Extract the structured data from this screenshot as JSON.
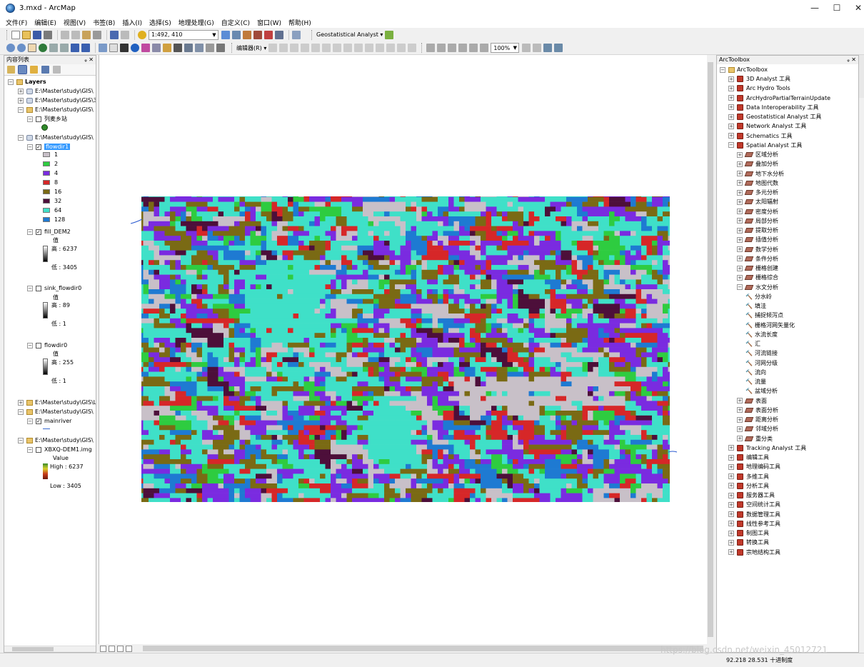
{
  "window": {
    "title": "3.mxd - ArcMap",
    "minimize": "—",
    "maximize": "☐",
    "close": "✕"
  },
  "menus": [
    "文件(F)",
    "编辑(E)",
    "视图(V)",
    "书签(B)",
    "插入(I)",
    "选择(S)",
    "地理处理(G)",
    "自定义(C)",
    "窗口(W)",
    "帮助(H)"
  ],
  "toolbar1": {
    "scale": "1:492, 410",
    "geostat_label": "Geostatistical Analyst ▾"
  },
  "toolbar2": {
    "editor_label": "编辑器(R) ▾",
    "zoom_percent": "100%"
  },
  "toc": {
    "title": "内容列表",
    "root": "Layers",
    "nodes": [
      {
        "label": "E:\\Master\\study\\GIS\\"
      },
      {
        "label": "E:\\Master\\study\\GIS\\3"
      },
      {
        "label": "E:\\Master\\study\\GIS\\"
      },
      {
        "label": "列麦乡站"
      },
      {
        "label": "E:\\Master\\study\\GIS\\"
      },
      {
        "label": "flowdir1"
      },
      {
        "label": "fill_DEM2"
      },
      {
        "label": "值"
      },
      {
        "label": "高 : 6237"
      },
      {
        "label": "低 : 3405"
      },
      {
        "label": "sink_flowdir0"
      },
      {
        "label": "值"
      },
      {
        "label": "高 : 89"
      },
      {
        "label": "低 : 1"
      },
      {
        "label": "flowdir0"
      },
      {
        "label": "值"
      },
      {
        "label": "高 : 255"
      },
      {
        "label": "低 : 1"
      },
      {
        "label": "E:\\Master\\study\\GIS\\L"
      },
      {
        "label": "E:\\Master\\study\\GIS\\"
      },
      {
        "label": "mainriver"
      },
      {
        "label": "E:\\Master\\study\\GIS\\"
      },
      {
        "label": "XBXQ-DEM1.img"
      },
      {
        "label": "Value"
      },
      {
        "label": "High : 6237"
      },
      {
        "label": "Low : 3405"
      }
    ],
    "legend": [
      {
        "label": "1",
        "color": "#c8c0c8"
      },
      {
        "label": "2",
        "color": "#2ecc40"
      },
      {
        "label": "4",
        "color": "#7a2be0"
      },
      {
        "label": "8",
        "color": "#d62728"
      },
      {
        "label": "16",
        "color": "#7a6a14"
      },
      {
        "label": "32",
        "color": "#4d0f3a"
      },
      {
        "label": "64",
        "color": "#3fe0c8"
      },
      {
        "label": "128",
        "color": "#1e7ad2"
      }
    ]
  },
  "toolbox": {
    "title": "ArcToolbox",
    "root": "ArcToolbox",
    "items": [
      {
        "label": "3D Analyst 工具"
      },
      {
        "label": "Arc Hydro Tools"
      },
      {
        "label": "ArcHydroPartialTerrainUpdate"
      },
      {
        "label": "Data Interoperability 工具"
      },
      {
        "label": "Geostatistical Analyst 工具"
      },
      {
        "label": "Network Analyst 工具"
      },
      {
        "label": "Schematics 工具"
      },
      {
        "label": "Spatial Analyst 工具"
      },
      {
        "label": "区域分析"
      },
      {
        "label": "叠加分析"
      },
      {
        "label": "地下水分析"
      },
      {
        "label": "地图代数"
      },
      {
        "label": "多元分析"
      },
      {
        "label": "太阳辐射"
      },
      {
        "label": "密度分析"
      },
      {
        "label": "局部分析"
      },
      {
        "label": "提取分析"
      },
      {
        "label": "插值分析"
      },
      {
        "label": "数学分析"
      },
      {
        "label": "条件分析"
      },
      {
        "label": "栅格创建"
      },
      {
        "label": "栅格综合"
      },
      {
        "label": "水文分析"
      },
      {
        "label": "分水岭"
      },
      {
        "label": "填洼"
      },
      {
        "label": "捕捉倾泻点"
      },
      {
        "label": "栅格河网矢量化"
      },
      {
        "label": "水流长度"
      },
      {
        "label": "汇"
      },
      {
        "label": "河流链接"
      },
      {
        "label": "河网分级"
      },
      {
        "label": "流向"
      },
      {
        "label": "流量"
      },
      {
        "label": "盆域分析"
      },
      {
        "label": "表面"
      },
      {
        "label": "表面分析"
      },
      {
        "label": "距离分析"
      },
      {
        "label": "邻域分析"
      },
      {
        "label": "重分类"
      },
      {
        "label": "Tracking Analyst 工具"
      },
      {
        "label": "编辑工具"
      },
      {
        "label": "地理编码工具"
      },
      {
        "label": "多维工具"
      },
      {
        "label": "分析工具"
      },
      {
        "label": "服务器工具"
      },
      {
        "label": "空间统计工具"
      },
      {
        "label": "数据管理工具"
      },
      {
        "label": "线性参考工具"
      },
      {
        "label": "制图工具"
      },
      {
        "label": "转换工具"
      },
      {
        "label": "宗地结构工具"
      }
    ]
  },
  "status": {
    "coords": "92.218  28.531 十进制度",
    "watermark": "https://blog.csdn.net/weixin_45012721"
  }
}
